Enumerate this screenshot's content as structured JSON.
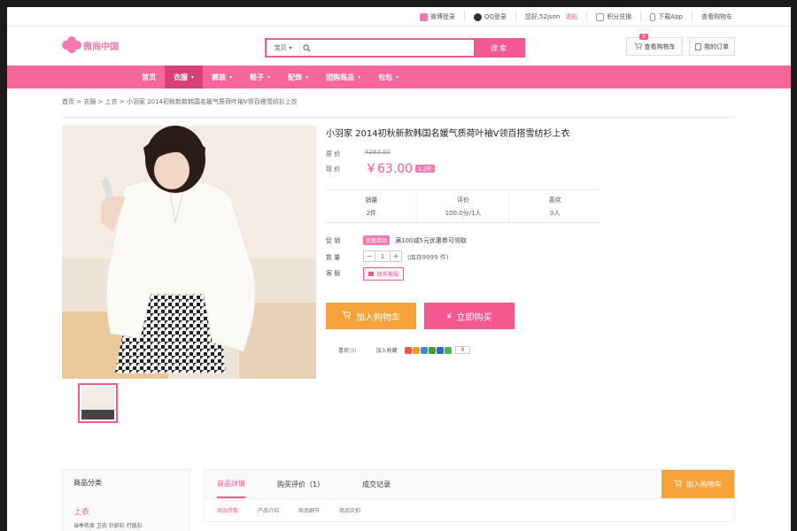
{
  "topbar": {
    "weibo": "微博登录",
    "qq": "QQ登录",
    "greeting": "您好,52json",
    "logout": "退出",
    "points": "积分兑换",
    "app": "下载App",
    "cart": "查看购物车"
  },
  "header": {
    "logo": "微尚中国",
    "search_category": "宝贝",
    "search_placeholder": "",
    "search_button": "搜 索",
    "cart_button": "查看购物车",
    "cart_count": "0",
    "orders_button": "我的订单"
  },
  "nav": {
    "items": [
      {
        "label": "首页"
      },
      {
        "label": "衣服"
      },
      {
        "label": "裤装"
      },
      {
        "label": "鞋子"
      },
      {
        "label": "配饰"
      },
      {
        "label": "团购商品"
      },
      {
        "label": "包包"
      }
    ],
    "active_index": 1,
    "dropdown_arrow": "▾"
  },
  "breadcrumb": "首页 > 衣服 > 上衣 > 小羽家 2014初秋新款韩国名媛气质荷叶袖V领百搭雪纺衫上衣",
  "product": {
    "title": "小羽家 2014初秋新款韩国名媛气质荷叶袖V领百搭雪纺衫上衣",
    "orig_label": "原 价",
    "orig_price": "¥283.50",
    "price_label": "现 价",
    "price": "￥63.00",
    "price_tag": "2.2折",
    "stats": [
      {
        "label": "销量",
        "value": "2件"
      },
      {
        "label": "评价",
        "value": "100.0分/1人"
      },
      {
        "label": "喜欢",
        "value": "0人"
      }
    ],
    "promo_label": "促 销",
    "promo_tag": "优惠活动",
    "promo_text": "满100减5元优惠券可领取",
    "qty_label": "数 量",
    "qty_minus": "−",
    "qty_value": "1",
    "qty_plus": "+",
    "stock_text": "(库存9999 件)",
    "service_label": "客 服",
    "service_button": "联系客服",
    "add_cart": "加入购物车",
    "buy_now": "立即购买",
    "like_label": "喜欢",
    "like_count": "(0)",
    "collect_label": "加入收藏",
    "share_count": "0"
  },
  "sidebar": {
    "title": "商品分类",
    "sub": "上衣",
    "items": "当季热卖  卫衣  针织衫  打底衫"
  },
  "detail_tabs": {
    "tabs": [
      "商品详情",
      "购买评价（1）",
      "成交记录"
    ],
    "add_cart": "加入购物车",
    "sub_tabs": [
      "商品参数",
      "产品介绍",
      "商品细节",
      "商品实拍"
    ]
  },
  "colors": {
    "brand_pink": "#f3588f",
    "nav_pink": "#f5679b",
    "orange": "#f6a23a"
  }
}
